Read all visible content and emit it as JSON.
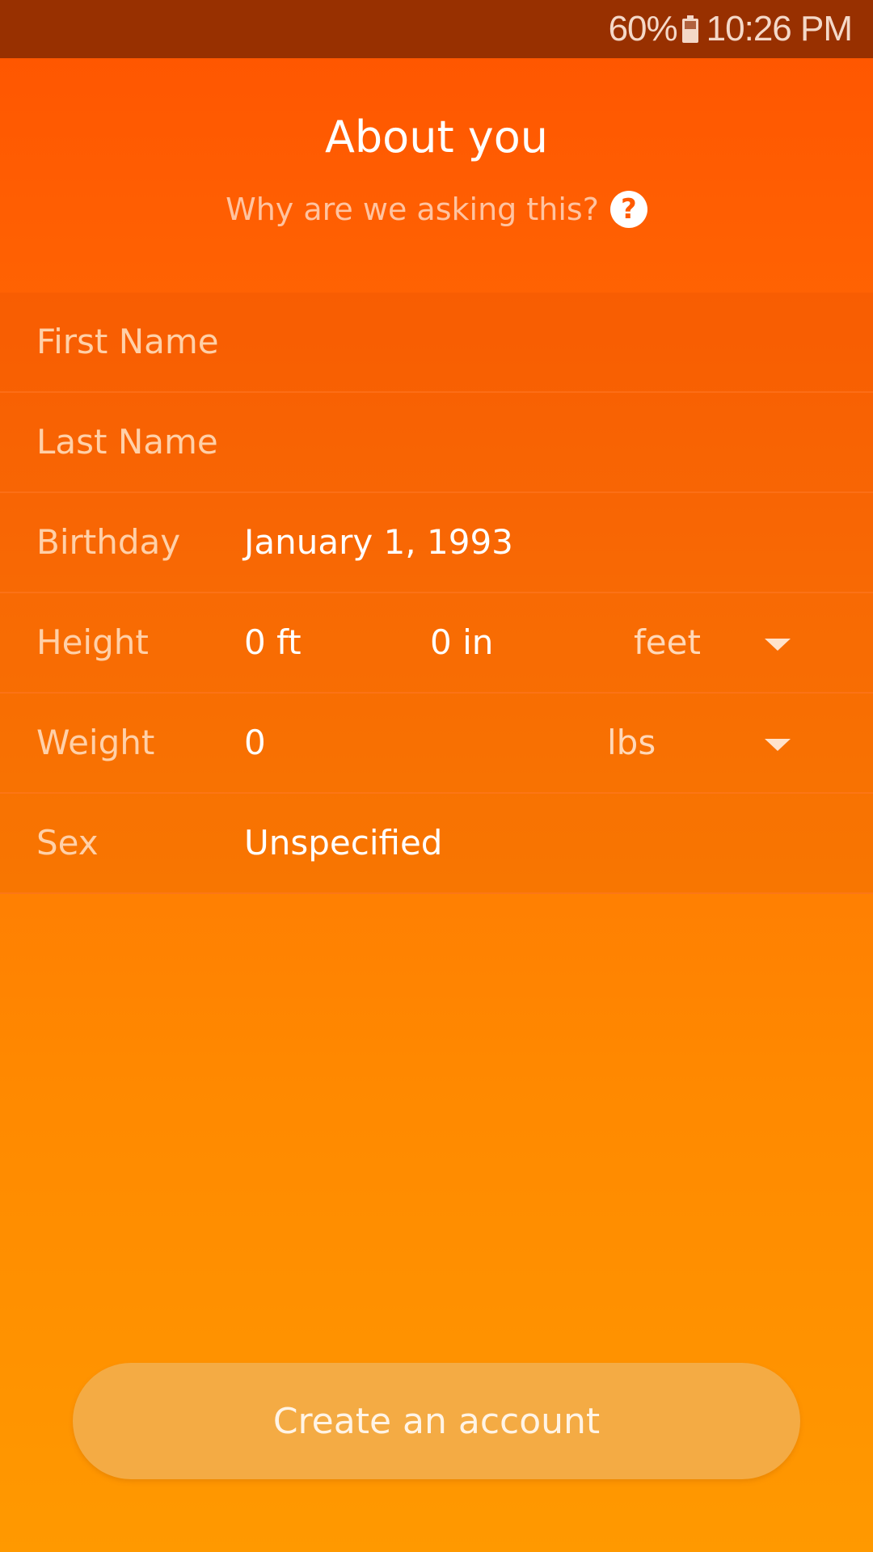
{
  "status_bar": {
    "battery": "60%",
    "time": "10:26 PM"
  },
  "header": {
    "title": "About you",
    "subtitle": "Why are we asking this?",
    "help_glyph": "?"
  },
  "form": {
    "first_name": {
      "label": "First Name",
      "value": ""
    },
    "last_name": {
      "label": "Last Name",
      "value": ""
    },
    "birthday": {
      "label": "Birthday",
      "value": "January 1, 1993"
    },
    "height": {
      "label": "Height",
      "feet": "0 ft",
      "inches": "0 in",
      "unit": "feet"
    },
    "weight": {
      "label": "Weight",
      "value": "0",
      "unit": "lbs"
    },
    "sex": {
      "label": "Sex",
      "value": "Unspecified"
    }
  },
  "actions": {
    "create_label": "Create an account"
  },
  "colors": {
    "status_bar": "#983000",
    "accent_top": "#ff5400",
    "accent_bottom": "#ff9900",
    "button": "#f4ab44"
  }
}
